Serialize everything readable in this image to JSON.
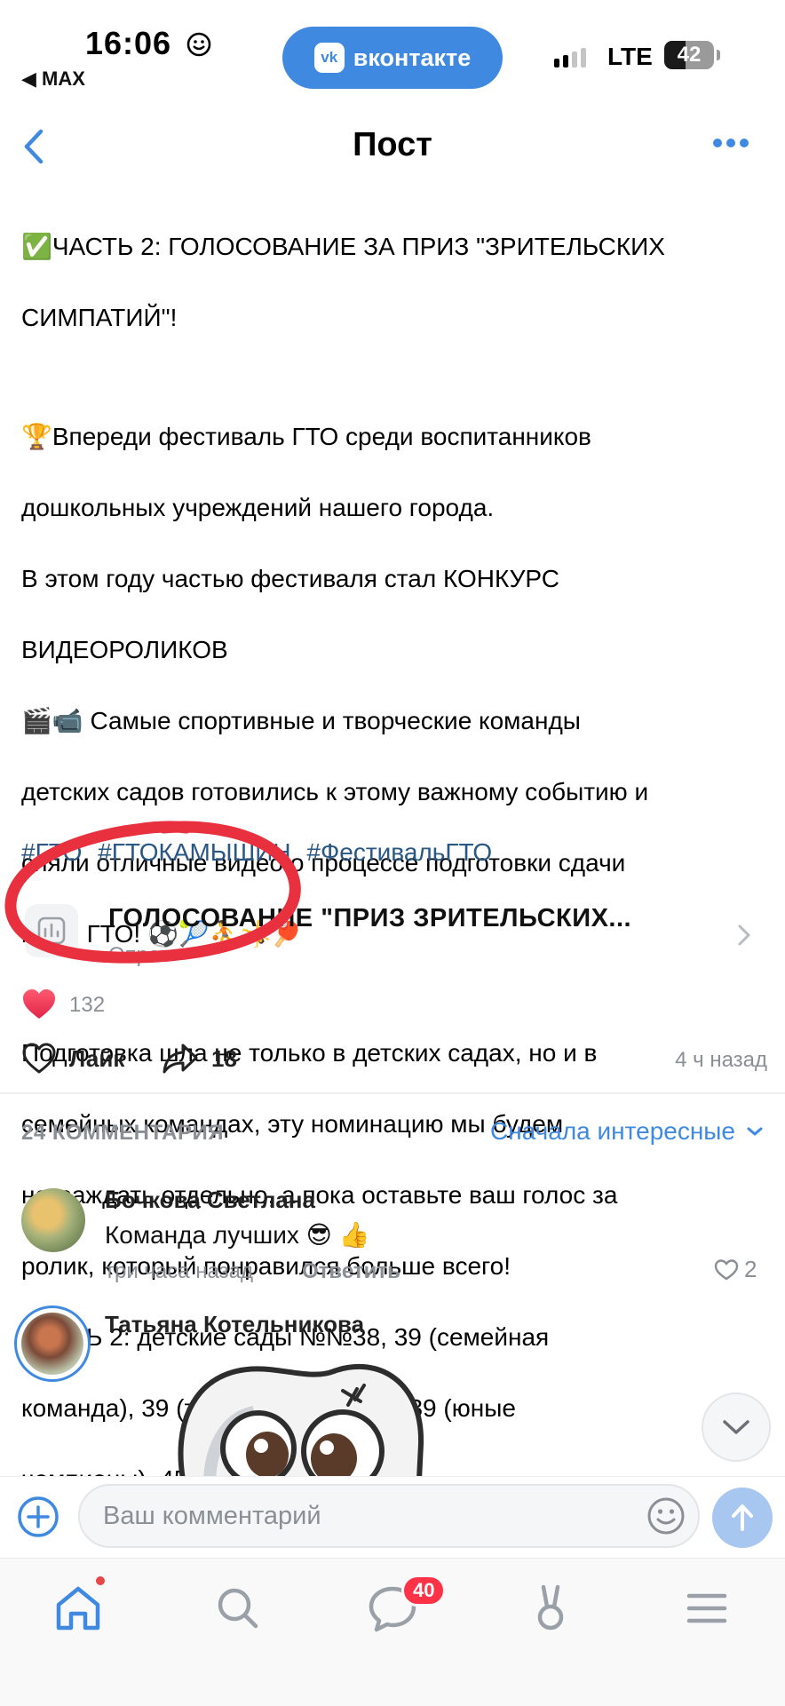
{
  "status_bar": {
    "time": "16:06",
    "back_app": "◀ MAX",
    "app_pill": "вконтакте",
    "vk_logo": "vk",
    "network": "LTE",
    "battery": "42",
    "battery_level": 0.42
  },
  "nav": {
    "title": "Пост"
  },
  "post": {
    "paragraph1": [
      "✅ЧАСТЬ 2: ГОЛОСОВАНИЕ ЗА ПРИЗ \"ЗРИТЕЛЬСКИХ",
      "СИМПАТИЙ\"!"
    ],
    "paragraph2": [
      "🏆Впереди фестиваль ГТО среди воспитанников",
      "дошкольных учреждений нашего города.",
      "В этом году частью фестиваля стал КОНКУРС",
      "ВИДЕОРОЛИКОВ",
      "🎬📹 Самые спортивные и творческие команды",
      "детских садов готовились к этому важному событию и",
      "сняли отличные видео о процессе подготовки сдачи",
      "норм ГТО! ⚽🎾⛹🤸🏓"
    ],
    "paragraph3": [
      "Подготовка шла не только в детских садах, но и в",
      "семейных командах, эту номинацию мы будем",
      "награждать отдельно, а пока оставьте ваш голос за",
      "ролик, который понравился больше всего!",
      "ЧАСТЬ 2: детские сады №№38, 39 (семейная",
      "команда), 39 (творческий ролик), 39 (юные",
      "чемпионы), 45, 46, 47"
    ],
    "hashtags": [
      "#ГТО",
      "#ГТОКАМЫШИН",
      "#ФестивальГТО"
    ]
  },
  "poll": {
    "title": "ГОЛОСОВАНИЕ \"ПРИЗ ЗРИТЕЛЬСКИХ...",
    "subtitle": "Опрос"
  },
  "reactions": {
    "count": "132"
  },
  "actions": {
    "like_label": "Лайк",
    "share_count": "18",
    "time": "4 ч назад"
  },
  "comments": {
    "count_label": "24 КОММЕНТАРИЯ",
    "sort_label": "Сначала интересные",
    "items": [
      {
        "author": "Бочкова Светлана",
        "text": "Команда лучших 😎 👍",
        "time": "три часа назад",
        "reply": "Ответить",
        "likes": "2"
      },
      {
        "author": "Татьяна Котельникова"
      }
    ]
  },
  "compose": {
    "placeholder": "Ваш комментарий"
  },
  "tabbar": {
    "messages_badge": "40"
  },
  "colors": {
    "accent": "#3f8ae0",
    "link": "#2a5885",
    "muted": "#8a8f96",
    "badge": "#ff3347",
    "annotation": "#e8303f"
  }
}
